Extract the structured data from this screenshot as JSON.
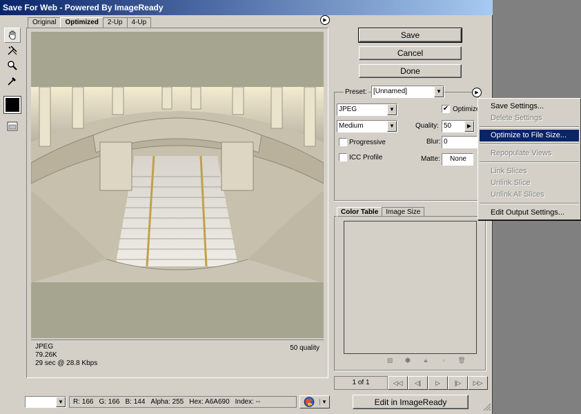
{
  "window": {
    "title": "Save For Web - Powered By ImageReady"
  },
  "tabs": [
    "Original",
    "Optimized",
    "2-Up",
    "4-Up"
  ],
  "tools": [
    "hand-icon",
    "slice-select-icon",
    "zoom-icon",
    "eyedropper-icon"
  ],
  "preview_info": {
    "format": "JPEG",
    "size": "79.26K",
    "time": "29 sec @ 28.8 Kbps",
    "quality": "50 quality"
  },
  "buttons": {
    "save": "Save",
    "cancel": "Cancel",
    "done": "Done",
    "edit": "Edit in ImageReady"
  },
  "settings": {
    "preset_label": "Preset:",
    "preset_value": "[Unnamed]",
    "format": "JPEG",
    "quality_level": "Medium",
    "optimized_label": "Optimized",
    "quality_label": "Quality:",
    "quality_value": "50",
    "blur_label": "Blur:",
    "blur_value": "0",
    "matte_label": "Matte:",
    "matte_value": "None",
    "progressive_label": "Progressive",
    "icc_label": "ICC Profile"
  },
  "color_tabs": [
    "Color Table",
    "Image Size"
  ],
  "navigator": {
    "page": "1 of 1"
  },
  "readout": {
    "r": "R:   166",
    "g": "G:   166",
    "b": "B:   144",
    "alpha": "Alpha:  255",
    "hex": "Hex:    A6A690",
    "index": "Index:    --"
  },
  "menu": {
    "items": [
      "Save Settings...",
      "Delete Settings",
      "Optimize to File Size...",
      "Repopulate Views",
      "Link Slices",
      "Unlink Slice",
      "Unlink All Slices",
      "Edit Output Settings..."
    ]
  },
  "colors": {
    "title_start": "#0a246a",
    "dialog": "#d4d0c8",
    "highlight": "#0a246a",
    "canvas": "#a6a690"
  }
}
